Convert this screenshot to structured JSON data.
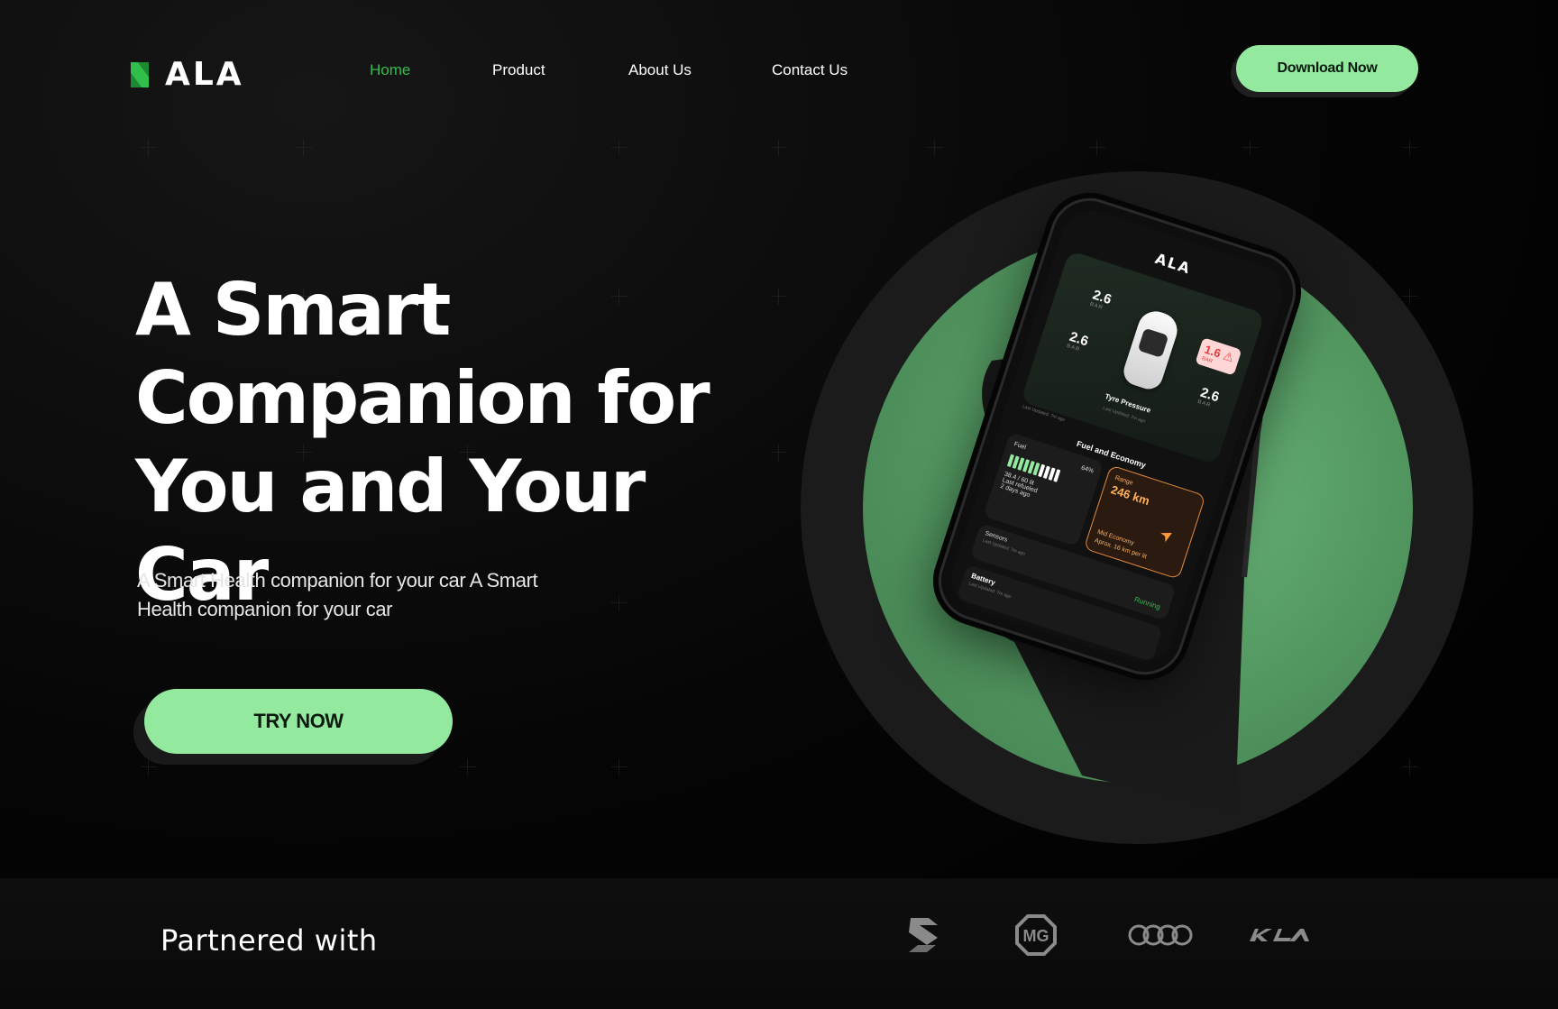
{
  "brand": {
    "name": "ALA",
    "accent": "#93ea9f",
    "nav_active": "#2fbf4a"
  },
  "nav": {
    "items": [
      {
        "label": "Home",
        "active": true
      },
      {
        "label": "Product",
        "active": false
      },
      {
        "label": "About Us",
        "active": false
      },
      {
        "label": "Contact Us",
        "active": false
      }
    ],
    "cta_label": "Download Now"
  },
  "hero": {
    "title_lines": [
      "A Smart",
      "Companion for",
      "You and Your Car"
    ],
    "subtitle": "A Smart Health companion  for your car A Smart Health companion  for your car",
    "cta_label": "TRY NOW"
  },
  "app_preview": {
    "logo": "ALA",
    "tyre": {
      "front_left": "2.6",
      "front_right": "1.6",
      "rear_left": "2.6",
      "rear_right": "2.6",
      "unit": "BAR",
      "label": "Tyre Pressure",
      "updated": "Last Updated: 7m ago"
    },
    "fuel": {
      "title": "Fuel and Economy",
      "updated": "Last Updated: 7m ago",
      "label": "Fuel",
      "percent": "64%",
      "amount": "38.4 / 60 lit",
      "refuel_line1": "Last refueled",
      "refuel_line2": "2 days ago",
      "level": 0.64
    },
    "range": {
      "label": "Range",
      "value": "246 km",
      "economy_label": "Mid Economy",
      "economy_detail": "Aprox. 16 km per lit"
    },
    "sensors": {
      "label": "Sensors",
      "updated": "Last Updated: 7m ago",
      "status": "Running"
    },
    "battery": {
      "label": "Battery",
      "updated": "Last Updated: 7m ago"
    }
  },
  "partners": {
    "label": "Partnered with",
    "logos": [
      "suzuki-logo",
      "mg-logo",
      "audi-logo",
      "kia-logo"
    ]
  }
}
